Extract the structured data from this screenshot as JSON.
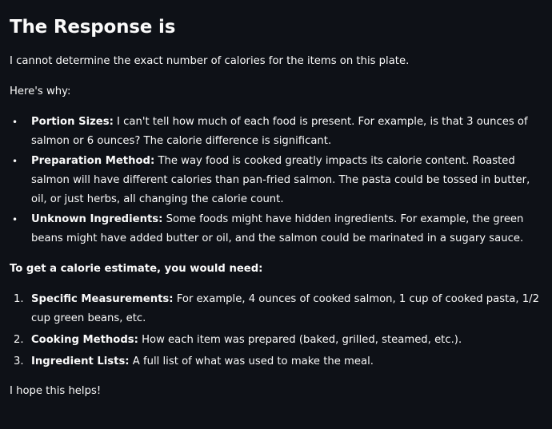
{
  "title": "The Response is",
  "intro": "I cannot determine the exact number of calories for the items on this plate.",
  "why_heading": "Here's why:",
  "reasons": [
    {
      "label": "Portion Sizes:",
      "text": " I can't tell how much of each food is present. For example, is that 3 ounces of salmon or 6 ounces? The calorie difference is significant."
    },
    {
      "label": "Preparation Method:",
      "text": " The way food is cooked greatly impacts its calorie content. Roasted salmon will have different calories than pan-fried salmon. The pasta could be tossed in butter, oil, or just herbs, all changing the calorie count."
    },
    {
      "label": "Unknown Ingredients:",
      "text": " Some foods might have hidden ingredients. For example, the green beans might have added butter or oil, and the salmon could be marinated in a sugary sauce."
    }
  ],
  "need_heading": "To get a calorie estimate, you would need:",
  "needs": [
    {
      "num": "1.",
      "label": "Specific Measurements:",
      "text": " For example, 4 ounces of cooked salmon, 1 cup of cooked pasta, 1/2 cup green beans, etc."
    },
    {
      "num": "2.",
      "label": "Cooking Methods:",
      "text": " How each item was prepared (baked, grilled, steamed, etc.)."
    },
    {
      "num": "3.",
      "label": "Ingredient Lists:",
      "text": " A full list of what was used to make the meal."
    }
  ],
  "closing": "I hope this helps!",
  "bullet_glyph": "•"
}
